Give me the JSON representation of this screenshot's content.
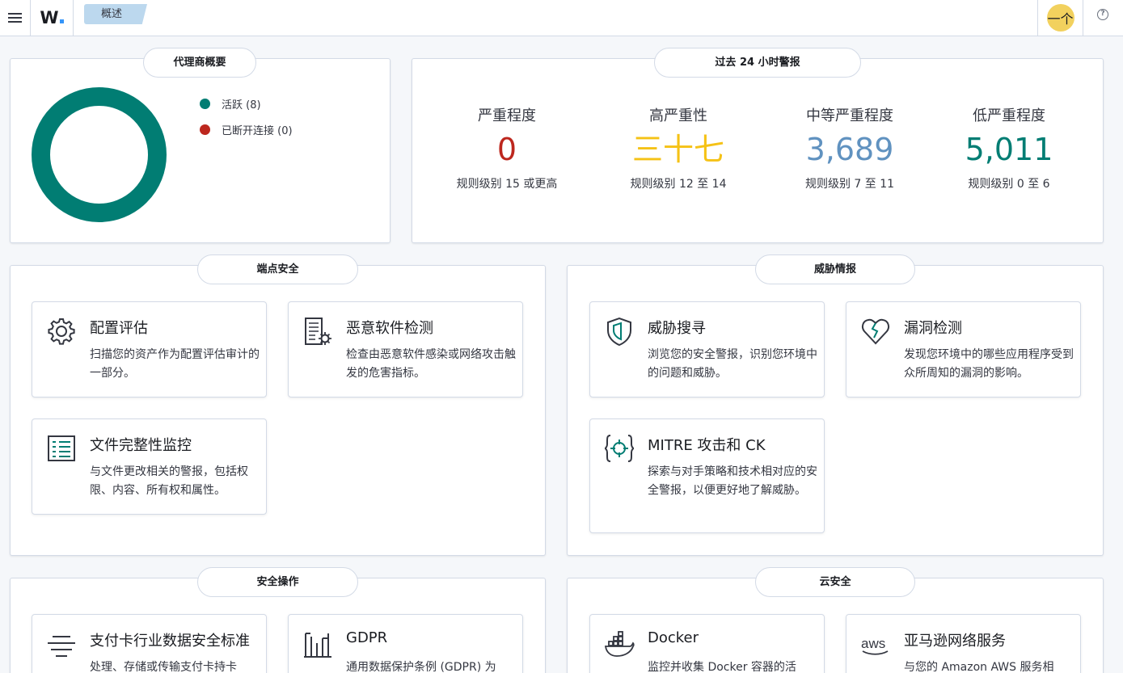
{
  "header": {
    "logo_text": "W",
    "breadcrumb": "概述",
    "avatar_text": "一个",
    "help_text": "?"
  },
  "agents": {
    "title": "代理商概要",
    "legend": [
      {
        "label": "活跃 (8)",
        "color": "#017d73"
      },
      {
        "label": "已断开连接 (0)",
        "color": "#bd271e"
      }
    ]
  },
  "alerts": {
    "title": "过去 24 小时警报",
    "stats": [
      {
        "label": "严重程度",
        "value": "0",
        "sub": "规则级别 15 或更高",
        "color": "#bd271e"
      },
      {
        "label": "高严重性",
        "value": "三十七",
        "sub": "规则级别 12 至 14",
        "color": "#f5c216"
      },
      {
        "label": "中等严重程度",
        "value": "3,689",
        "sub": "规则级别 7 至 11",
        "color": "#6092c0"
      },
      {
        "label": "低严重程度",
        "value": "5,011",
        "sub": "规则级别 0 至 6",
        "color": "#017d73"
      }
    ]
  },
  "sections": {
    "endpoint": {
      "title": "端点安全",
      "cards": [
        {
          "icon": "gear-icon",
          "title": "配置评估",
          "desc": "扫描您的资产作为配置评估审计的一部分。"
        },
        {
          "icon": "malware-doc-icon",
          "title": "恶意软件检测",
          "desc": "检查由恶意软件感染或网络攻击触发的危害指标。"
        },
        {
          "icon": "file-list-icon",
          "title": "文件完整性监控",
          "desc": "与文件更改相关的警报，包括权限、内容、所有权和属性。"
        }
      ]
    },
    "threat": {
      "title": "威胁情报",
      "cards": [
        {
          "icon": "shield-icon",
          "title": "威胁搜寻",
          "desc": "浏览您的安全警报，识别您环境中的问题和威胁。"
        },
        {
          "icon": "broken-heart-icon",
          "title": "漏洞检测",
          "desc": "发现您环境中的哪些应用程序受到众所周知的漏洞的影响。"
        },
        {
          "icon": "target-icon",
          "title": "MITRE 攻击和 CK",
          "desc": "探索与对手策略和技术相对应的安全警报，以便更好地了解威胁。"
        }
      ]
    },
    "secops": {
      "title": "安全操作",
      "cards": [
        {
          "icon": "pci-lines-icon",
          "title": "支付卡行业数据安全标准",
          "desc": "处理、存储或传输支付卡持卡"
        },
        {
          "icon": "gdpr-pillars-icon",
          "title": "GDPR",
          "desc": "通用数据保护条例 (GDPR) 为"
        }
      ]
    },
    "cloud": {
      "title": "云安全",
      "cards": [
        {
          "icon": "docker-icon",
          "title": "Docker",
          "desc": "监控并收集 Docker 容器的活"
        },
        {
          "icon": "aws-icon",
          "title": "亚马逊网络服务",
          "desc": "与您的 Amazon AWS 服务相"
        }
      ]
    }
  }
}
